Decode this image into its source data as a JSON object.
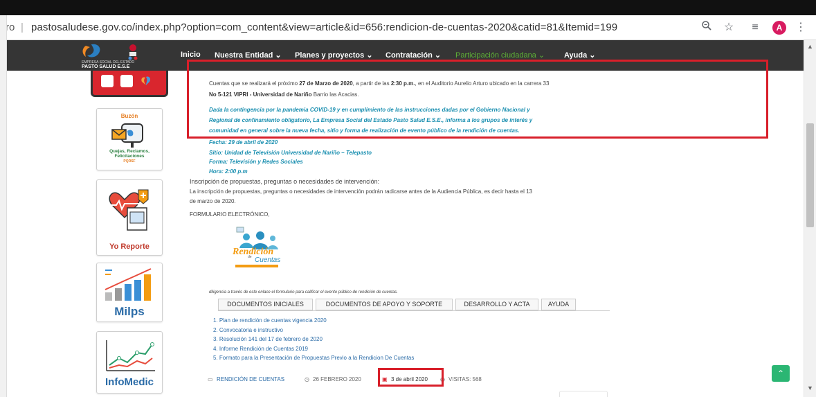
{
  "browser": {
    "url_prefix": "ro",
    "url": "pastosaludese.gov.co/index.php?option=com_content&view=article&id=656:rendicion-de-cuentas-2020&catid=81&Itemid=199",
    "avatar_letter": "A"
  },
  "site": {
    "logo_line1": "EMPRESA SOCIAL DEL ESTADO",
    "logo_line2": "PASTO SALUD E.S.E",
    "nav": [
      {
        "label": "Inicio"
      },
      {
        "label": "Nuestra Entidad ⌄"
      },
      {
        "label": "Planes y proyectos ⌄"
      },
      {
        "label": "Contratación ⌄"
      },
      {
        "label": "Participación ciudadana ⌄"
      },
      {
        "label": "Ayuda ⌄"
      }
    ]
  },
  "sidebar": {
    "buzon": {
      "title": "Buzón",
      "caption1": "Quejas, Reclamos,",
      "caption2": "Felicitaciones",
      "caption3": "PQRSF"
    },
    "reporte": {
      "caption": "Yo Reporte"
    },
    "milps": {
      "caption": "Milps"
    },
    "infomedic": {
      "caption": "InfoMedic"
    }
  },
  "content": {
    "intro_line1_pre": "Cuentas que se realizará el próximo ",
    "intro_line1_bold": "27 de Marzo de 2020",
    "intro_line1_mid": ", a partir de las ",
    "intro_line1_bold2": "2:30 p.m.",
    "intro_line1_post": ", en el Auditorio Aurelio Arturo ubicado en la carrera 33",
    "intro_line2_bold": "No 5-121 VIPRI - Universidad de Nariño",
    "intro_line2_post": " Barrio las Acacias.",
    "notice_lines": [
      "Dada la contingencia por la pandemia COVID-19 y en cumplimiento de las instrucciones dadas por el Gobierno Nacional y",
      "Regional de confinamiento obligatorio, La Empresa Social del Estado Pasto Salud E.S.E., informa a los grupos de interés y",
      "comunidad en general sobre la nueva fecha, sitio y forma de realización de evento público de la rendición de cuentas."
    ],
    "fecha": "Fecha: 29 de abril de 2020",
    "sitio": "Sitio: Unidad de Televisión Universidad de Nariño – Telepasto",
    "forma": "Forma: Televisión y Redes Sociales",
    "hora": "Hora: 2:00 p.m",
    "inscripcion_title": "Inscripción de propuestas, preguntas o necesidades de intervención:",
    "inscripcion_line1": "La inscripción de propuestas, preguntas o necesidades de intervención podrán radicarse antes de la Audiencia Pública, es decir hasta el 13",
    "inscripcion_line2": "de marzo de 2020.",
    "formulario": "FORMULARIO ELECTRÓNICO,",
    "badge_line1": "Rendición",
    "badge_line2": "de",
    "badge_line3": "Cuentas",
    "diligencia": "diligencia a través de este enlace el formulario para calificar el evento público de rendición de cuentas.",
    "tabs": [
      "DOCUMENTOS INICIALES",
      "DOCUMENTOS DE APOYO Y SOPORTE",
      "DESARROLLO Y ACTA",
      "AYUDA"
    ],
    "docs": [
      "1. Plan de rendición de cuentas vigencia 2020",
      "2. Convocatoria e instructivo",
      "3. Resolución 141 del 17 de febrero de 2020",
      "4. Informe Rendición de Cuentas 2019",
      "5. Formato para la Presentación de Propuestas Previo a la Rendicion De Cuentas"
    ],
    "meta_category": "RENDICIÓN DE CUENTAS",
    "meta_created": "26 FEBRERO 2020",
    "meta_modified": "3 de abril 2020",
    "meta_visits": "VISITAS: 568"
  },
  "colors": {
    "nav_bg": "#353535",
    "active_nav": "#5fb336",
    "highlight": "#d81f2a",
    "notice_text": "#1a8fb0",
    "link": "#2a6ba7"
  }
}
